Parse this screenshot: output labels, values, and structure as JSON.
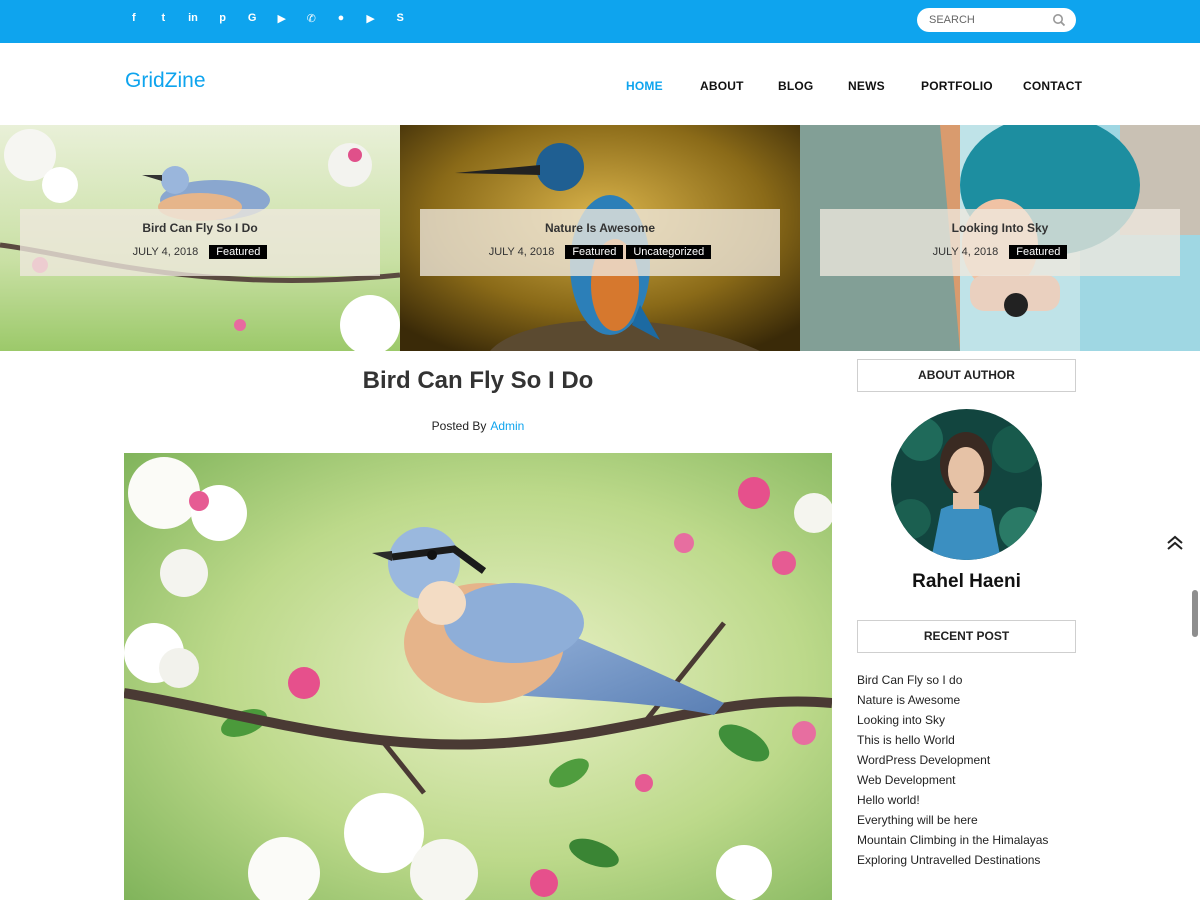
{
  "topbar": {
    "social_icons": [
      {
        "name": "facebook-icon",
        "glyph": "f"
      },
      {
        "name": "twitter-icon",
        "glyph": "t"
      },
      {
        "name": "linkedin-icon",
        "glyph": "in"
      },
      {
        "name": "pinterest-icon",
        "glyph": "p"
      },
      {
        "name": "google-icon",
        "glyph": "G"
      },
      {
        "name": "youtube-icon",
        "glyph": "▶"
      },
      {
        "name": "whatsapp-icon",
        "glyph": "✆"
      },
      {
        "name": "wechat-icon",
        "glyph": "●"
      },
      {
        "name": "youtube-alt-icon",
        "glyph": "▶"
      },
      {
        "name": "skype-icon",
        "glyph": "S"
      }
    ],
    "search_placeholder": "SEARCH",
    "accent": "#0ea4ee"
  },
  "header": {
    "logo": "GridZine",
    "nav": [
      "HOME",
      "ABOUT",
      "BLOG",
      "NEWS",
      "PORTFOLIO",
      "CONTACT"
    ],
    "active_nav": "HOME"
  },
  "slider": [
    {
      "title": "Bird Can Fly So I Do",
      "date": "JULY 4, 2018",
      "tags": [
        "Featured"
      ]
    },
    {
      "title": "Nature Is Awesome",
      "date": "JULY 4, 2018",
      "tags": [
        "Featured",
        "Uncategorized"
      ]
    },
    {
      "title": "Looking Into Sky",
      "date": "JULY 4, 2018",
      "tags": [
        "Featured"
      ]
    }
  ],
  "post": {
    "title": "Bird Can Fly So I Do",
    "posted_by_label": "Posted By",
    "author": "Admin"
  },
  "sidebar": {
    "about_title": "ABOUT AUTHOR",
    "author_name": "Rahel Haeni",
    "recent_title": "RECENT POST",
    "recent_posts": [
      "Bird Can Fly so I do",
      "Nature is Awesome",
      "Looking into Sky",
      "This is hello World",
      "WordPress Development",
      "Web Development",
      "Hello world!",
      "Everything will be here",
      "Mountain Climbing in the Himalayas",
      "Exploring Untravelled Destinations"
    ]
  }
}
